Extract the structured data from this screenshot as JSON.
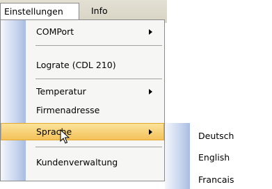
{
  "menubar": {
    "menus": [
      {
        "label": "Einstellungen"
      },
      {
        "label": "Info"
      }
    ]
  },
  "dropdown": {
    "items": [
      {
        "label": "COMPort"
      },
      {
        "label": "Lograte (CDL 210)"
      },
      {
        "label": "Temperatur"
      },
      {
        "label": "Firmenadresse"
      },
      {
        "label": "Sprache"
      },
      {
        "label": "Kundenverwaltung"
      }
    ]
  },
  "submenu": {
    "items": [
      {
        "label": "Deutsch"
      },
      {
        "label": "English"
      },
      {
        "label": "Francais"
      }
    ]
  },
  "cursor": {
    "icon": "mouse-pointer-icon"
  }
}
